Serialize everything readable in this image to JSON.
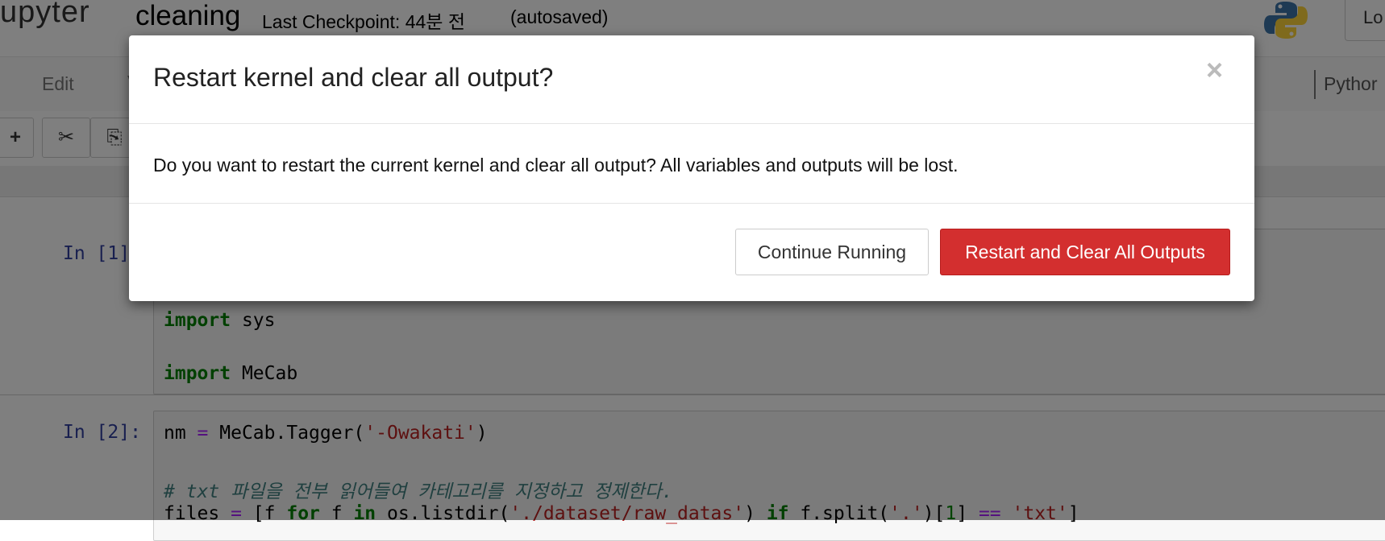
{
  "header": {
    "logo_text": "upyter",
    "notebook_name": "cleaning",
    "checkpoint": "Last Checkpoint: 44분 전",
    "autosaved": "(autosaved)",
    "logout_label": "Lo"
  },
  "menubar": {
    "edit": "Edit",
    "partial_item": "V",
    "kernel": "Pythor"
  },
  "toolbar": {
    "add": "+",
    "cut": "✂",
    "copy": "⎘"
  },
  "cells": [
    {
      "prompt": "In [1]:",
      "lines": [
        "import sys",
        "",
        "import MeCab"
      ]
    },
    {
      "prompt": "In [2]:",
      "line1": "nm = MeCab.Tagger('-Owakati')",
      "comment": "# txt 파일을 전부 읽어들여 카테고리를 지정하고 정제한다.",
      "line3": "files = [f for f in os.listdir('./dataset/raw_datas') if f.split('.')[1] == 'txt']"
    }
  ],
  "modal": {
    "title": "Restart kernel and clear all output?",
    "close": "×",
    "body": "Do you want to restart the current kernel and clear all output? All variables and outputs will be lost.",
    "continue_label": "Continue Running",
    "restart_label": "Restart and Clear All Outputs"
  },
  "colors": {
    "danger": "#d32f2f",
    "prompt": "#303f9f"
  }
}
